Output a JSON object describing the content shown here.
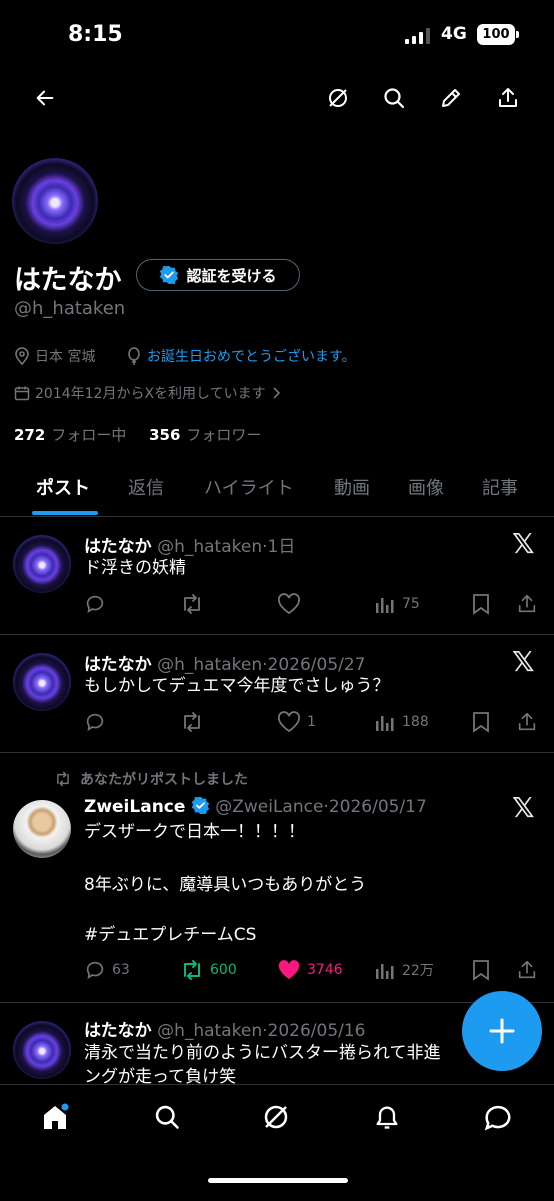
{
  "status_bar": {
    "time": "8:15",
    "network": "4G",
    "battery": "100"
  },
  "profile": {
    "name": "はたなか",
    "verify_label": "認証を受ける",
    "handle": "@h_hataken",
    "location": "日本 宮城",
    "birthday": "お誕生日おめでとうございます。",
    "joined": "2014年12月からXを利用しています",
    "following_count": "272",
    "following_label": "フォロー中",
    "followers_count": "356",
    "followers_label": "フォロワー"
  },
  "tabs": [
    "ポスト",
    "返信",
    "ハイライト",
    "動画",
    "画像",
    "記事"
  ],
  "posts": [
    {
      "name": "はたなか",
      "handle": "@h_hataken",
      "date": "1日",
      "text": "ド浮きの妖精",
      "views": "75"
    },
    {
      "name": "はたなか",
      "handle": "@h_hataken",
      "date": "2026/05/27",
      "text": "もしかしてデュエマ今年度でさしゅう？",
      "likes": "1",
      "views": "188"
    },
    {
      "repost_label": "あなたがリポストしました",
      "name": "ZweiLance",
      "handle": "@ZweiLance",
      "date": "2026/05/17",
      "text1": "デスザークで日本一！！！！",
      "text2": "8年ぶりに、魔導具いつもありがとう",
      "hashtag": "#デュエプレチームCS",
      "replies": "63",
      "reposts": "600",
      "likes": "3746",
      "views": "22万"
    },
    {
      "name": "はたなか",
      "handle": "@h_hataken",
      "date": "2026/05/16",
      "text1": "清永で当たり前のようにバスター捲られて非進",
      "text2": "ングが走って負け笑"
    }
  ],
  "colors": {
    "accent": "#1d9bf0",
    "repost": "#00ba7c",
    "like": "#f91880",
    "muted": "#71767b"
  }
}
